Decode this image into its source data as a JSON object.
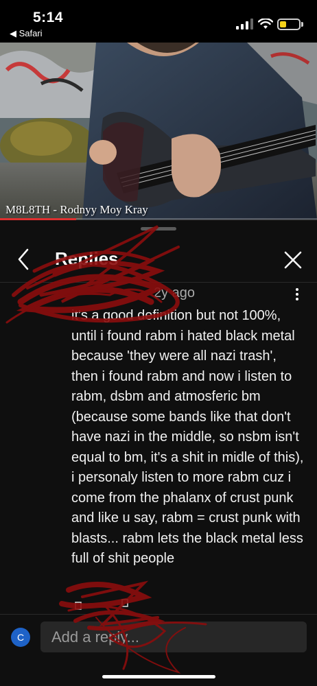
{
  "status_bar": {
    "time": "5:14",
    "back_app": "◀ Safari",
    "battery_level": 0.35
  },
  "video": {
    "title": "M8L8TH - Rodnyy Moy Kray",
    "progress": 0.24
  },
  "replies_panel": {
    "title": "Replies",
    "comment": {
      "timestamp": "2y ago",
      "text": "it's a good definition but not 100%, until i found rabm i hated black metal because 'they were all nazi trash', then i found rabm and now i listen to rabm, dsbm and atmosferic bm (because some bands like that don't have nazi in the middle, so nsbm isn't equal to bm, it's a shit in midle of this), i personaly listen to more rabm cuz i come from the phalanx of crust punk and like u say, rabm = crust punk with blasts... rabm lets the black metal less full of shit people"
    }
  },
  "reply_box": {
    "avatar_letter": "C",
    "placeholder": "Add a reply..."
  },
  "colors": {
    "panel_bg": "#0f0f0f",
    "progress": "#e03030",
    "avatar": "#1e62c7",
    "scribble": "#8b0d0d"
  }
}
